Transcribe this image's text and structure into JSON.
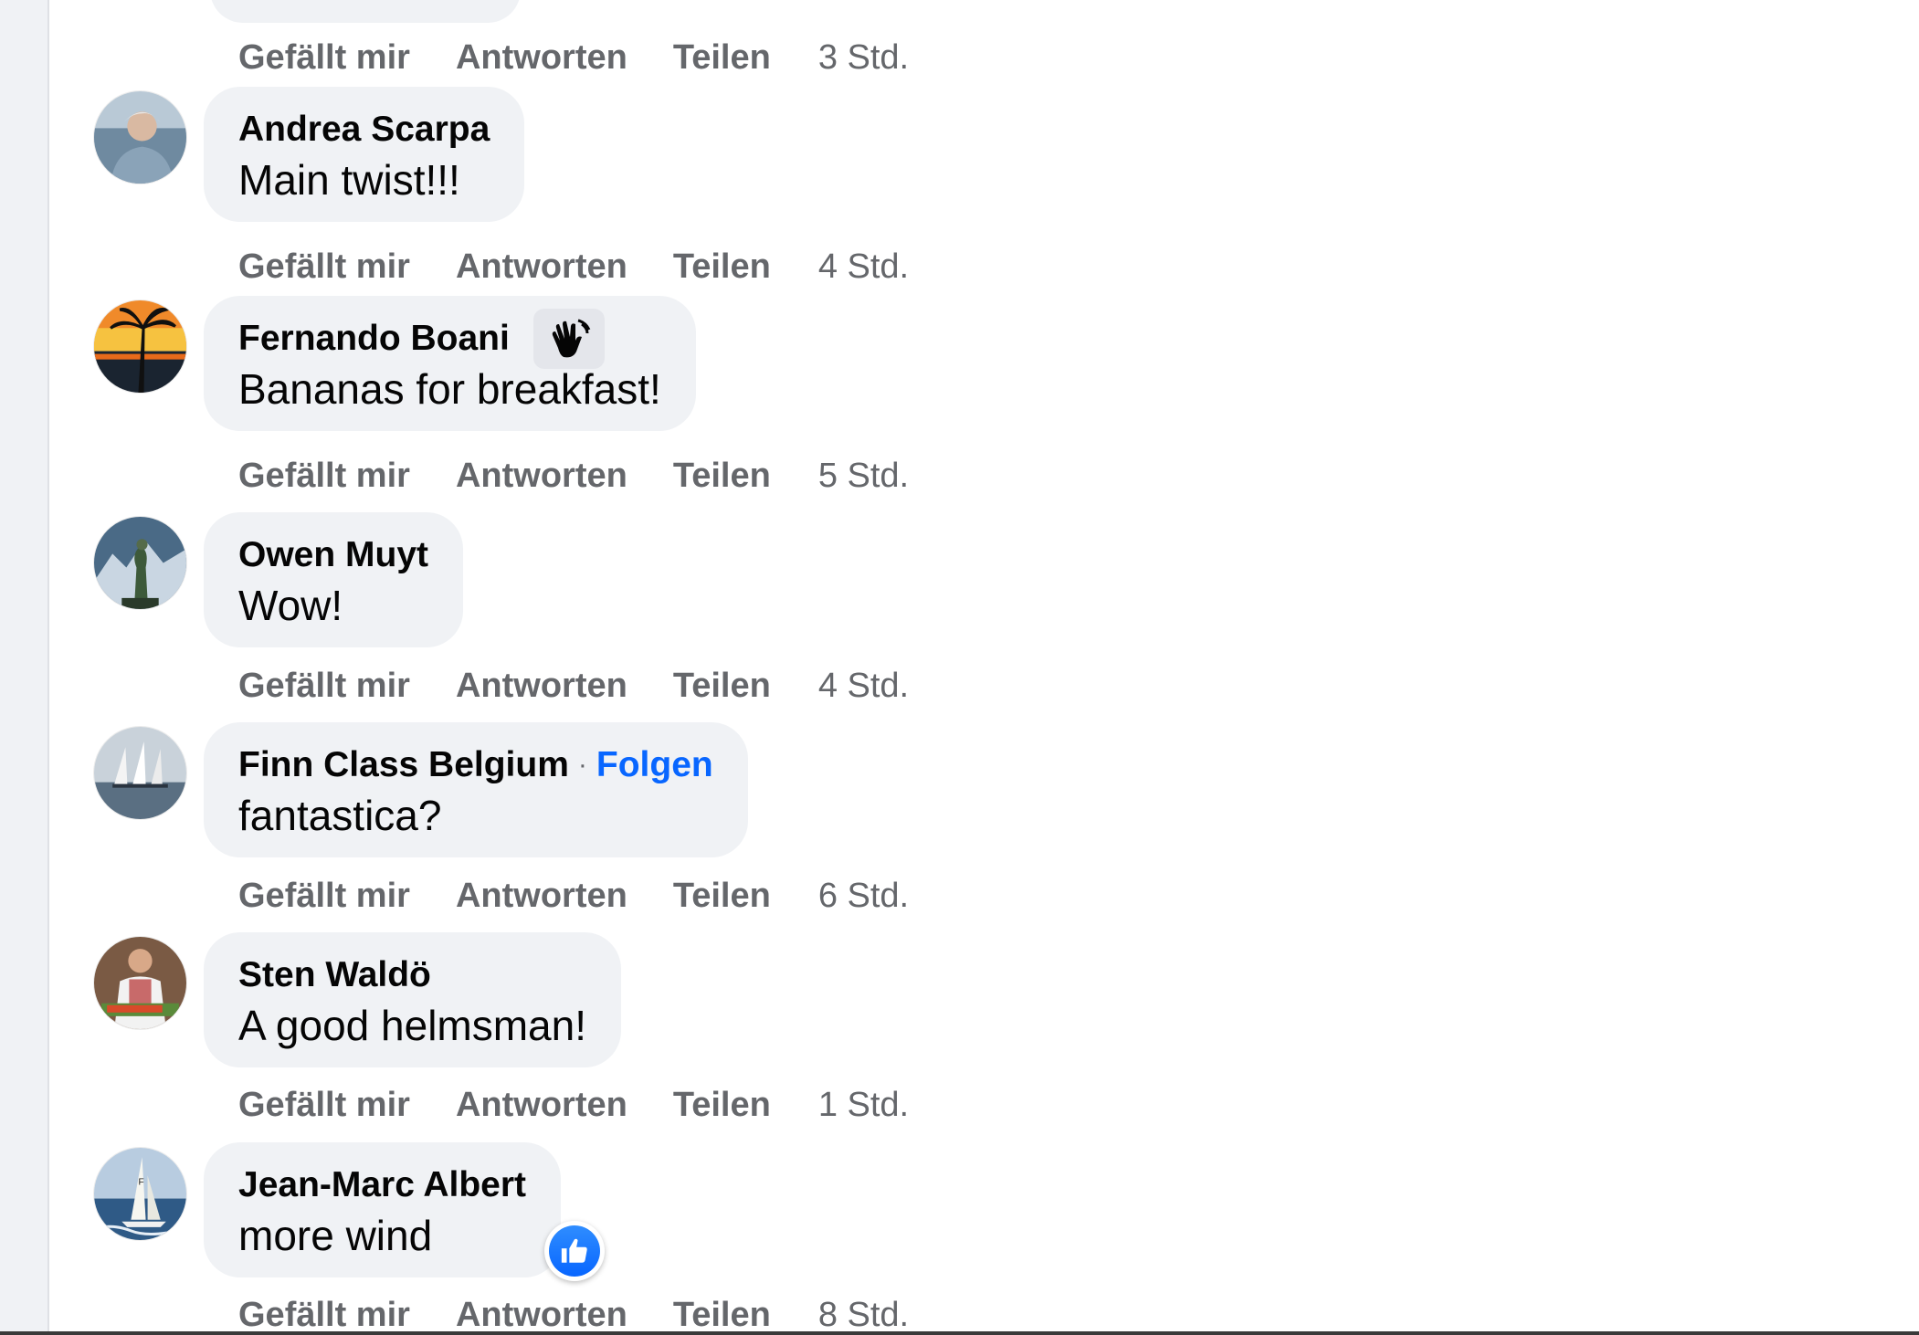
{
  "actions": {
    "like": "Gefällt mir",
    "reply": "Antworten",
    "share": "Teilen"
  },
  "previous_comment": {
    "time": "3 Std."
  },
  "comments": [
    {
      "name": "Andrea Scarpa",
      "text": "Main twist!!!",
      "time": "4 Std.",
      "avatar_icon": "avatar-photo-man-by-sea"
    },
    {
      "name": "Fernando Boani",
      "text": "Bananas for breakfast!",
      "time": "5 Std.",
      "avatar_icon": "avatar-photo-palm-sunset",
      "badge_icon": "waving-hand-icon"
    },
    {
      "name": "Owen Muyt",
      "text": "Wow!",
      "time": "4 Std.",
      "avatar_icon": "avatar-photo-statue"
    },
    {
      "name": "Finn Class Belgium",
      "follow": "Folgen",
      "separator": "·",
      "text": "fantastica?",
      "time": "6 Std.",
      "avatar_icon": "avatar-photo-sailboats"
    },
    {
      "name": "Sten Waldö",
      "text": "A good helmsman!",
      "time": "1 Std.",
      "avatar_icon": "avatar-photo-chef"
    },
    {
      "name": "Jean-Marc Albert",
      "text": "more wind",
      "time": "8 Std.",
      "avatar_icon": "avatar-photo-sailing",
      "reaction_icon": "like-thumbs-up-icon"
    }
  ],
  "colors": {
    "bubble": "#f0f2f5",
    "secondary_text": "#65676b",
    "link": "#0866ff"
  }
}
